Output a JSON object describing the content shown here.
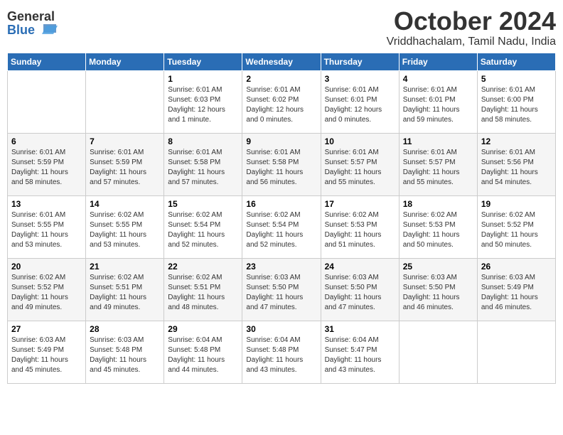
{
  "logo": {
    "general": "General",
    "blue": "Blue"
  },
  "title": "October 2024",
  "location": "Vriddhachalam, Tamil Nadu, India",
  "days": [
    "Sunday",
    "Monday",
    "Tuesday",
    "Wednesday",
    "Thursday",
    "Friday",
    "Saturday"
  ],
  "weeks": [
    [
      {
        "date": "",
        "sunrise": "",
        "sunset": "",
        "daylight": ""
      },
      {
        "date": "",
        "sunrise": "",
        "sunset": "",
        "daylight": ""
      },
      {
        "date": "1",
        "sunrise": "Sunrise: 6:01 AM",
        "sunset": "Sunset: 6:03 PM",
        "daylight": "Daylight: 12 hours and 1 minute."
      },
      {
        "date": "2",
        "sunrise": "Sunrise: 6:01 AM",
        "sunset": "Sunset: 6:02 PM",
        "daylight": "Daylight: 12 hours and 0 minutes."
      },
      {
        "date": "3",
        "sunrise": "Sunrise: 6:01 AM",
        "sunset": "Sunset: 6:01 PM",
        "daylight": "Daylight: 12 hours and 0 minutes."
      },
      {
        "date": "4",
        "sunrise": "Sunrise: 6:01 AM",
        "sunset": "Sunset: 6:01 PM",
        "daylight": "Daylight: 11 hours and 59 minutes."
      },
      {
        "date": "5",
        "sunrise": "Sunrise: 6:01 AM",
        "sunset": "Sunset: 6:00 PM",
        "daylight": "Daylight: 11 hours and 58 minutes."
      }
    ],
    [
      {
        "date": "6",
        "sunrise": "Sunrise: 6:01 AM",
        "sunset": "Sunset: 5:59 PM",
        "daylight": "Daylight: 11 hours and 58 minutes."
      },
      {
        "date": "7",
        "sunrise": "Sunrise: 6:01 AM",
        "sunset": "Sunset: 5:59 PM",
        "daylight": "Daylight: 11 hours and 57 minutes."
      },
      {
        "date": "8",
        "sunrise": "Sunrise: 6:01 AM",
        "sunset": "Sunset: 5:58 PM",
        "daylight": "Daylight: 11 hours and 57 minutes."
      },
      {
        "date": "9",
        "sunrise": "Sunrise: 6:01 AM",
        "sunset": "Sunset: 5:58 PM",
        "daylight": "Daylight: 11 hours and 56 minutes."
      },
      {
        "date": "10",
        "sunrise": "Sunrise: 6:01 AM",
        "sunset": "Sunset: 5:57 PM",
        "daylight": "Daylight: 11 hours and 55 minutes."
      },
      {
        "date": "11",
        "sunrise": "Sunrise: 6:01 AM",
        "sunset": "Sunset: 5:57 PM",
        "daylight": "Daylight: 11 hours and 55 minutes."
      },
      {
        "date": "12",
        "sunrise": "Sunrise: 6:01 AM",
        "sunset": "Sunset: 5:56 PM",
        "daylight": "Daylight: 11 hours and 54 minutes."
      }
    ],
    [
      {
        "date": "13",
        "sunrise": "Sunrise: 6:01 AM",
        "sunset": "Sunset: 5:55 PM",
        "daylight": "Daylight: 11 hours and 53 minutes."
      },
      {
        "date": "14",
        "sunrise": "Sunrise: 6:02 AM",
        "sunset": "Sunset: 5:55 PM",
        "daylight": "Daylight: 11 hours and 53 minutes."
      },
      {
        "date": "15",
        "sunrise": "Sunrise: 6:02 AM",
        "sunset": "Sunset: 5:54 PM",
        "daylight": "Daylight: 11 hours and 52 minutes."
      },
      {
        "date": "16",
        "sunrise": "Sunrise: 6:02 AM",
        "sunset": "Sunset: 5:54 PM",
        "daylight": "Daylight: 11 hours and 52 minutes."
      },
      {
        "date": "17",
        "sunrise": "Sunrise: 6:02 AM",
        "sunset": "Sunset: 5:53 PM",
        "daylight": "Daylight: 11 hours and 51 minutes."
      },
      {
        "date": "18",
        "sunrise": "Sunrise: 6:02 AM",
        "sunset": "Sunset: 5:53 PM",
        "daylight": "Daylight: 11 hours and 50 minutes."
      },
      {
        "date": "19",
        "sunrise": "Sunrise: 6:02 AM",
        "sunset": "Sunset: 5:52 PM",
        "daylight": "Daylight: 11 hours and 50 minutes."
      }
    ],
    [
      {
        "date": "20",
        "sunrise": "Sunrise: 6:02 AM",
        "sunset": "Sunset: 5:52 PM",
        "daylight": "Daylight: 11 hours and 49 minutes."
      },
      {
        "date": "21",
        "sunrise": "Sunrise: 6:02 AM",
        "sunset": "Sunset: 5:51 PM",
        "daylight": "Daylight: 11 hours and 49 minutes."
      },
      {
        "date": "22",
        "sunrise": "Sunrise: 6:02 AM",
        "sunset": "Sunset: 5:51 PM",
        "daylight": "Daylight: 11 hours and 48 minutes."
      },
      {
        "date": "23",
        "sunrise": "Sunrise: 6:03 AM",
        "sunset": "Sunset: 5:50 PM",
        "daylight": "Daylight: 11 hours and 47 minutes."
      },
      {
        "date": "24",
        "sunrise": "Sunrise: 6:03 AM",
        "sunset": "Sunset: 5:50 PM",
        "daylight": "Daylight: 11 hours and 47 minutes."
      },
      {
        "date": "25",
        "sunrise": "Sunrise: 6:03 AM",
        "sunset": "Sunset: 5:50 PM",
        "daylight": "Daylight: 11 hours and 46 minutes."
      },
      {
        "date": "26",
        "sunrise": "Sunrise: 6:03 AM",
        "sunset": "Sunset: 5:49 PM",
        "daylight": "Daylight: 11 hours and 46 minutes."
      }
    ],
    [
      {
        "date": "27",
        "sunrise": "Sunrise: 6:03 AM",
        "sunset": "Sunset: 5:49 PM",
        "daylight": "Daylight: 11 hours and 45 minutes."
      },
      {
        "date": "28",
        "sunrise": "Sunrise: 6:03 AM",
        "sunset": "Sunset: 5:48 PM",
        "daylight": "Daylight: 11 hours and 45 minutes."
      },
      {
        "date": "29",
        "sunrise": "Sunrise: 6:04 AM",
        "sunset": "Sunset: 5:48 PM",
        "daylight": "Daylight: 11 hours and 44 minutes."
      },
      {
        "date": "30",
        "sunrise": "Sunrise: 6:04 AM",
        "sunset": "Sunset: 5:48 PM",
        "daylight": "Daylight: 11 hours and 43 minutes."
      },
      {
        "date": "31",
        "sunrise": "Sunrise: 6:04 AM",
        "sunset": "Sunset: 5:47 PM",
        "daylight": "Daylight: 11 hours and 43 minutes."
      },
      {
        "date": "",
        "sunrise": "",
        "sunset": "",
        "daylight": ""
      },
      {
        "date": "",
        "sunrise": "",
        "sunset": "",
        "daylight": ""
      }
    ]
  ]
}
